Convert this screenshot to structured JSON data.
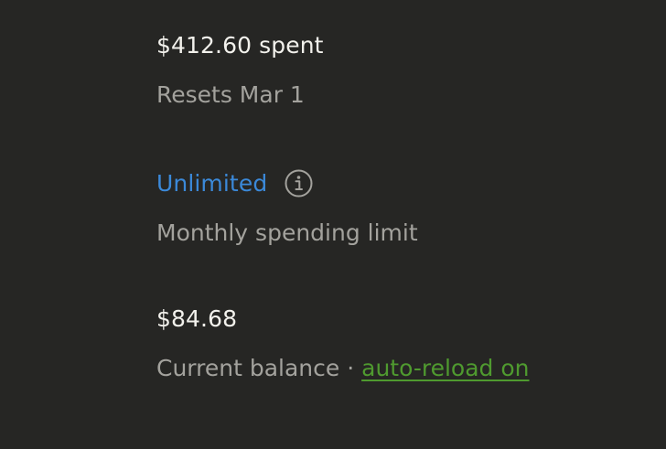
{
  "spent": {
    "amount": "$412.60 spent",
    "reset": "Resets Mar 1"
  },
  "limit": {
    "value": "Unlimited",
    "label": "Monthly spending limit",
    "icon": "info-icon",
    "value_color": "#3b89d9"
  },
  "balance": {
    "amount": "$84.68",
    "label": "Current balance",
    "separator": " · ",
    "auto_reload_link": "auto-reload on",
    "link_color": "#4f9a2f"
  }
}
